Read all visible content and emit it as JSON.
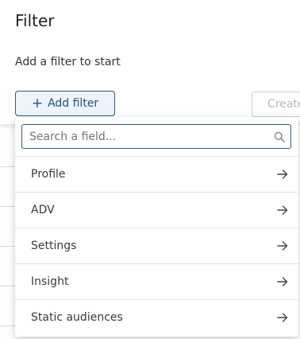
{
  "panel": {
    "title": "Filter",
    "hint": "Add a filter to start",
    "add_filter_label": "Add filter",
    "add_filter_icon": "plus-icon",
    "create_label": "Create"
  },
  "dropdown": {
    "search_placeholder": "Search a field...",
    "search_value": "",
    "search_icon": "search-icon",
    "items": [
      {
        "label": "Profile",
        "icon": "arrow-right-icon"
      },
      {
        "label": "ADV",
        "icon": "arrow-right-icon"
      },
      {
        "label": "Settings",
        "icon": "arrow-right-icon"
      },
      {
        "label": "Insight",
        "icon": "arrow-right-icon"
      },
      {
        "label": "Static audiences",
        "icon": "arrow-right-icon"
      }
    ]
  },
  "colors": {
    "accent": "#2e5b8a",
    "accent_bg": "#eef4fb",
    "disabled_text": "#b8b8b8"
  }
}
